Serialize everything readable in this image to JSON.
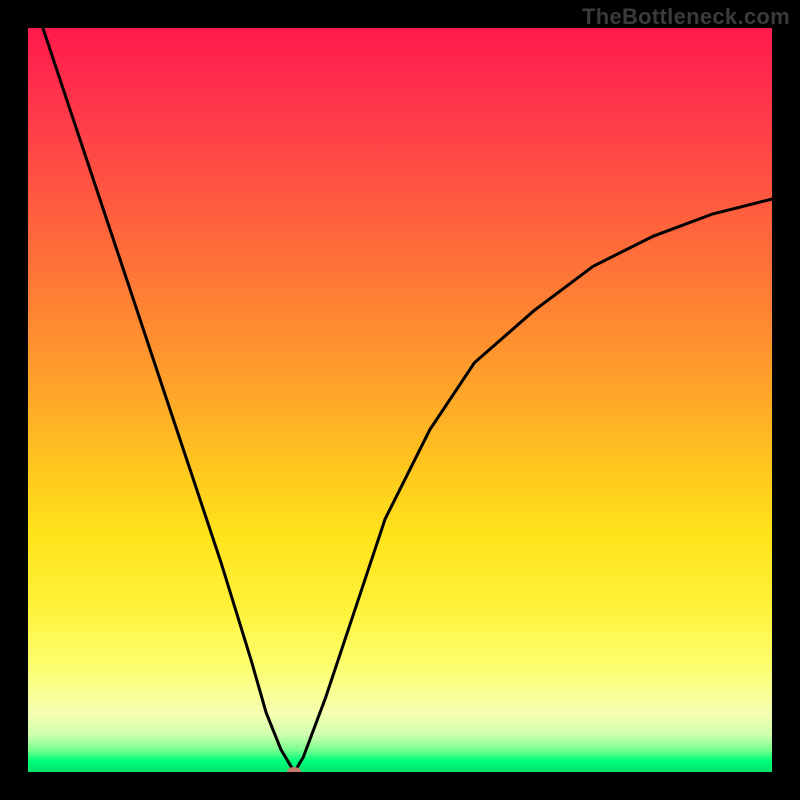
{
  "watermark": "TheBottleneck.com",
  "chart_data": {
    "type": "line",
    "title": "",
    "xlabel": "",
    "ylabel": "",
    "xlim": [
      0,
      100
    ],
    "ylim": [
      0,
      100
    ],
    "grid": false,
    "series": [
      {
        "name": "curve",
        "x": [
          2,
          6,
          10,
          14,
          18,
          22,
          26,
          30,
          32,
          34,
          35.8,
          37,
          40,
          44,
          48,
          54,
          60,
          68,
          76,
          84,
          92,
          100
        ],
        "y": [
          100,
          88,
          76,
          64,
          52,
          40,
          28,
          15,
          8,
          3,
          0,
          2,
          10,
          22,
          34,
          46,
          55,
          62,
          68,
          72,
          75,
          77
        ]
      }
    ],
    "marker": {
      "x": 35.8,
      "y": 0
    },
    "notes": "Values are approximate, read from a plot with no axis ticks; y expressed as percent of plot height from bottom. The sharp minimum (bottleneck point) is near x≈36."
  },
  "colors": {
    "frame": "#000000",
    "curve": "#000000",
    "marker": "#c77b6a",
    "gradient_top": "#ff1a4d",
    "gradient_bottom": "#00e36b"
  }
}
